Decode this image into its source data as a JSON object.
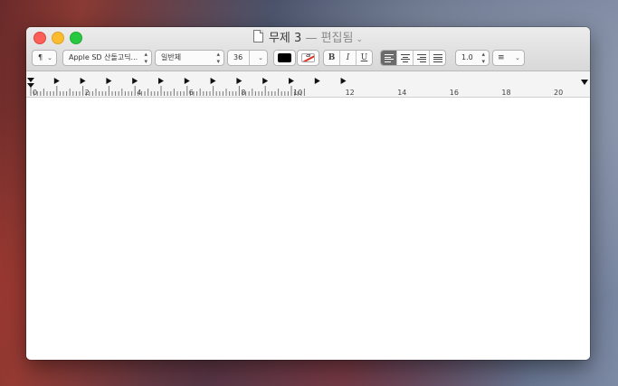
{
  "window": {
    "title": "무제 3",
    "separator": "—",
    "status": "편집됨"
  },
  "toolbar": {
    "paragraph_style": "¶",
    "font_family": "Apple SD 산돌고딕...",
    "font_style": "일반체",
    "font_size": "36",
    "text_color": "#000000",
    "bold": "B",
    "italic": "I",
    "underline": "U",
    "alignment_selected": "left",
    "line_spacing": "1.0"
  },
  "ruler": {
    "labels": [
      "0",
      "2",
      "4",
      "6",
      "8",
      "10",
      "12",
      "14",
      "16",
      "18",
      "20"
    ]
  },
  "editor": {
    "text": ""
  }
}
